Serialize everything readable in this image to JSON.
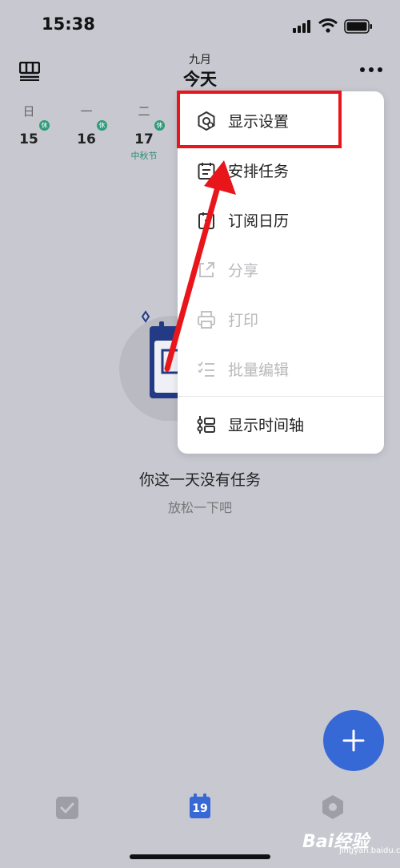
{
  "status_bar": {
    "time": "15:38"
  },
  "header": {
    "month": "九月",
    "title": "今天"
  },
  "week": {
    "days": [
      {
        "weekday": "日",
        "date": "15",
        "badge": "休",
        "holiday": ""
      },
      {
        "weekday": "一",
        "date": "16",
        "badge": "休",
        "holiday": ""
      },
      {
        "weekday": "二",
        "date": "17",
        "badge": "休",
        "holiday": "中秋节"
      }
    ]
  },
  "menu": {
    "items": [
      {
        "label": "显示设置",
        "icon": "display-settings-icon",
        "disabled": false
      },
      {
        "label": "安排任务",
        "icon": "schedule-task-icon",
        "disabled": false
      },
      {
        "label": "订阅日历",
        "icon": "subscribe-calendar-icon",
        "disabled": false
      },
      {
        "label": "分享",
        "icon": "share-icon",
        "disabled": true
      },
      {
        "label": "打印",
        "icon": "print-icon",
        "disabled": true
      },
      {
        "label": "批量编辑",
        "icon": "batch-edit-icon",
        "disabled": true
      },
      {
        "label": "显示时间轴",
        "icon": "timeline-icon",
        "disabled": false
      }
    ]
  },
  "empty_state": {
    "title": "你这一天没有任务",
    "subtitle": "放松一下吧"
  },
  "tab_bar": {
    "calendar_date": "19"
  },
  "watermark": {
    "text": "Bai经验",
    "sub": "jingyan.baidu.com"
  },
  "colors": {
    "accent": "#3769d6",
    "highlight": "#e8161b",
    "holiday_green": "#2e9c7a"
  }
}
